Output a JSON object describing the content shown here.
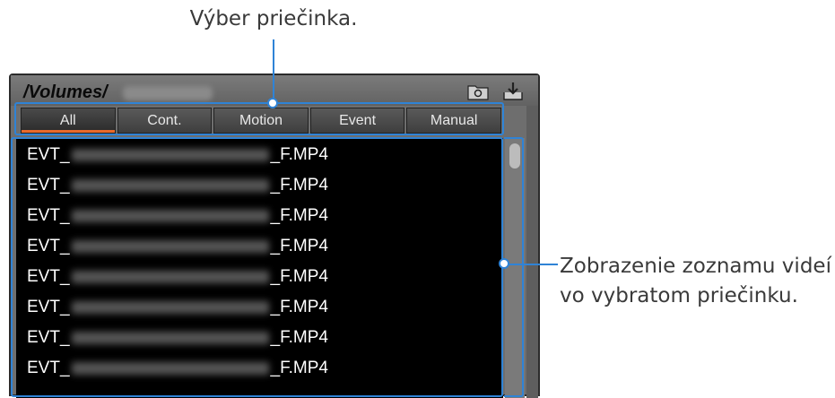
{
  "annotations": {
    "top_label": "Výber priečinka.",
    "right_label_line1": "Zobrazenie zoznamu videí",
    "right_label_line2": "vo vybratom priečinku."
  },
  "header": {
    "path": "/Volumes/",
    "icons": [
      "folder-icon",
      "download-icon"
    ]
  },
  "tabs": [
    {
      "label": "All",
      "active": true
    },
    {
      "label": "Cont.",
      "active": false
    },
    {
      "label": "Motion",
      "active": false
    },
    {
      "label": "Event",
      "active": false
    },
    {
      "label": "Manual",
      "active": false
    }
  ],
  "files": [
    {
      "prefix": "EVT_",
      "suffix": "_F.MP4"
    },
    {
      "prefix": "EVT_",
      "suffix": "_F.MP4"
    },
    {
      "prefix": "EVT_",
      "suffix": "_F.MP4"
    },
    {
      "prefix": "EVT_",
      "suffix": "_F.MP4"
    },
    {
      "prefix": "EVT_",
      "suffix": "_F.MP4"
    },
    {
      "prefix": "EVT_",
      "suffix": "_F.MP4"
    },
    {
      "prefix": "EVT_",
      "suffix": "_F.MP4"
    },
    {
      "prefix": "EVT_",
      "suffix": "_F.MP4"
    }
  ],
  "colors": {
    "accent": "#2f83d6",
    "active_tab_underline": "#e8692b",
    "list_background": "#000000"
  }
}
